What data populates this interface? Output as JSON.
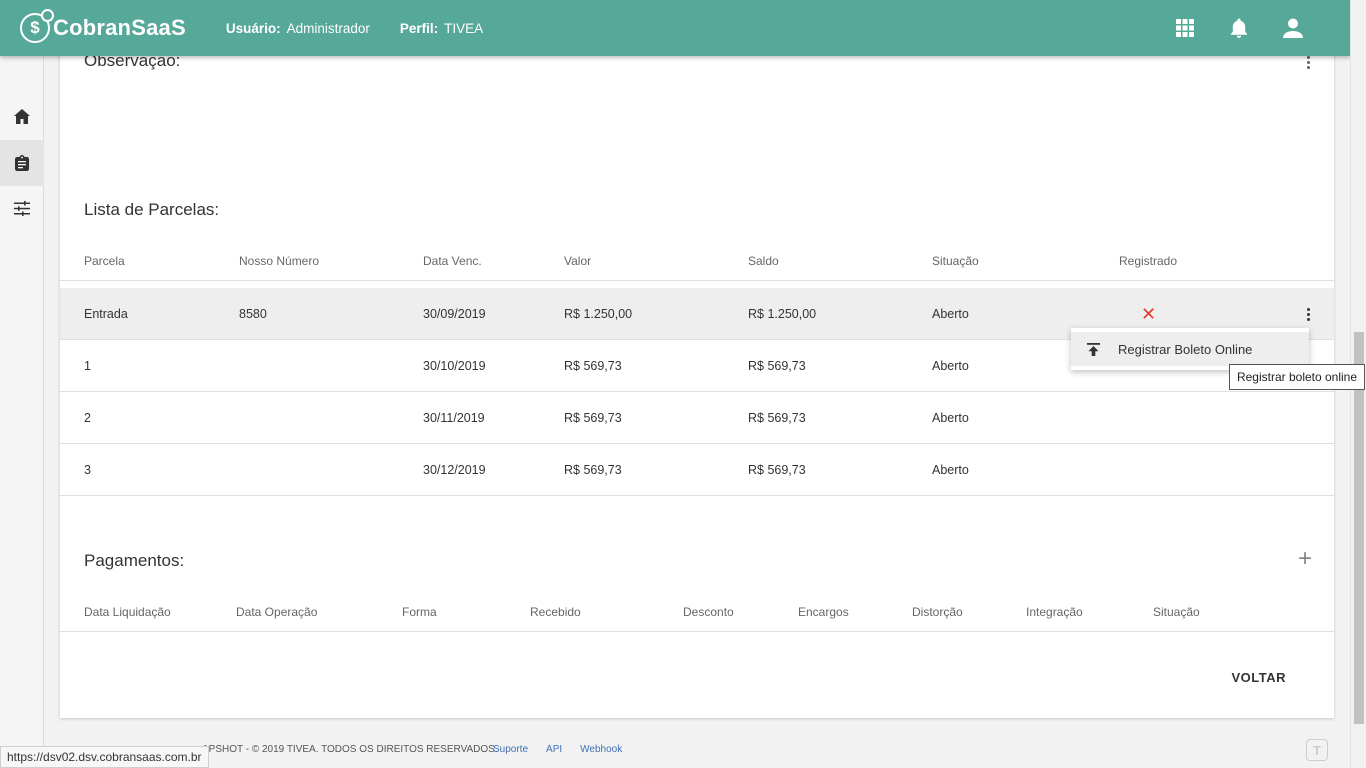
{
  "header": {
    "logo_text": "CobranSaaS",
    "user_label": "Usuário:",
    "user_value": "Administrador",
    "profile_label": "Perfil:",
    "profile_value": "TIVEA",
    "icons": [
      "apps-grid-icon",
      "bell-icon",
      "user-icon"
    ]
  },
  "sidebar": {
    "items": [
      {
        "name": "home",
        "icon": "home-icon"
      },
      {
        "name": "clipboard",
        "icon": "clipboard-icon",
        "active": true
      },
      {
        "name": "settings",
        "icon": "sliders-icon"
      }
    ]
  },
  "observacao": {
    "title": "Observação:"
  },
  "parcelas": {
    "title": "Lista de Parcelas:",
    "columns": [
      "Parcela",
      "Nosso Número",
      "Data Venc.",
      "Valor",
      "Saldo",
      "Situação",
      "Registrado"
    ],
    "rows": [
      {
        "parcela": "Entrada",
        "nosso_numero": "8580",
        "data_venc": "30/09/2019",
        "valor": "R$ 1.250,00",
        "saldo": "R$ 1.250,00",
        "situacao": "Aberto",
        "registrado": "✕"
      },
      {
        "parcela": "1",
        "nosso_numero": "",
        "data_venc": "30/10/2019",
        "valor": "R$ 569,73",
        "saldo": "R$ 569,73",
        "situacao": "Aberto",
        "registrado": ""
      },
      {
        "parcela": "2",
        "nosso_numero": "",
        "data_venc": "30/11/2019",
        "valor": "R$ 569,73",
        "saldo": "R$ 569,73",
        "situacao": "Aberto",
        "registrado": ""
      },
      {
        "parcela": "3",
        "nosso_numero": "",
        "data_venc": "30/12/2019",
        "valor": "R$ 569,73",
        "saldo": "R$ 569,73",
        "situacao": "Aberto",
        "registrado": ""
      }
    ]
  },
  "pagamentos": {
    "title": "Pagamentos:",
    "add_label": "+",
    "columns": [
      "Data Liquidação",
      "Data Operação",
      "Forma",
      "Recebido",
      "Desconto",
      "Encargos",
      "Distorção",
      "Integração",
      "Situação"
    ]
  },
  "actions": {
    "voltar": "VOLTAR"
  },
  "dropdown": {
    "item_label": "Registrar Boleto Online",
    "tooltip": "Registrar boleto online"
  },
  "footer": {
    "copyright": "APSHOT - © 2019 TIVEA. TODOS OS DIREITOS RESERVADOS.",
    "links": [
      "Suporte",
      "API",
      "Webhook"
    ],
    "brand": "T"
  },
  "statusbar": {
    "url": "https://dsv02.dsv.cobransaas.com.br"
  },
  "colors": {
    "header": "#56a899",
    "error": "#e53935",
    "link": "#3f6fb5"
  }
}
